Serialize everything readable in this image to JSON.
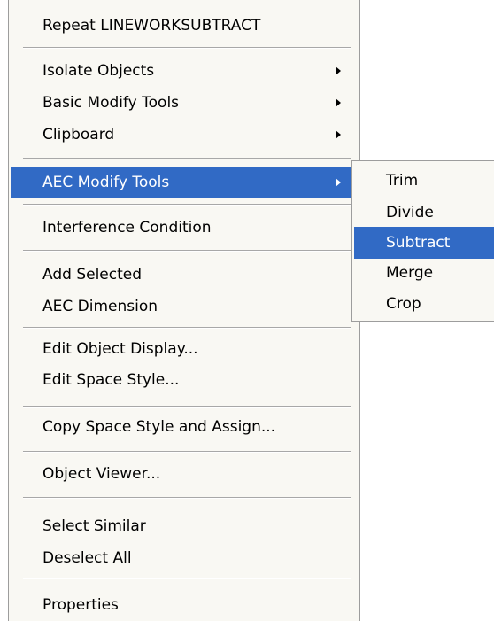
{
  "menu": {
    "items": [
      {
        "label": "Repeat LINEWORKSUBTRACT"
      },
      {
        "label": "Isolate Objects"
      },
      {
        "label": "Basic Modify Tools"
      },
      {
        "label": "Clipboard"
      },
      {
        "label": "AEC Modify Tools"
      },
      {
        "label": "Interference Condition"
      },
      {
        "label": "Add Selected"
      },
      {
        "label": "AEC Dimension"
      },
      {
        "label": "Edit Object Display..."
      },
      {
        "label": "Edit Space Style..."
      },
      {
        "label": "Copy Space Style and Assign..."
      },
      {
        "label": "Object Viewer..."
      },
      {
        "label": "Select Similar"
      },
      {
        "label": "Deselect All"
      },
      {
        "label": "Properties"
      }
    ]
  },
  "submenu": {
    "items": [
      {
        "label": "Trim"
      },
      {
        "label": "Divide"
      },
      {
        "label": "Subtract"
      },
      {
        "label": "Merge"
      },
      {
        "label": "Crop"
      }
    ]
  },
  "colors": {
    "highlight": "#316ac5",
    "menu_background": "#f9f8f3",
    "border": "#9d9d9d"
  }
}
